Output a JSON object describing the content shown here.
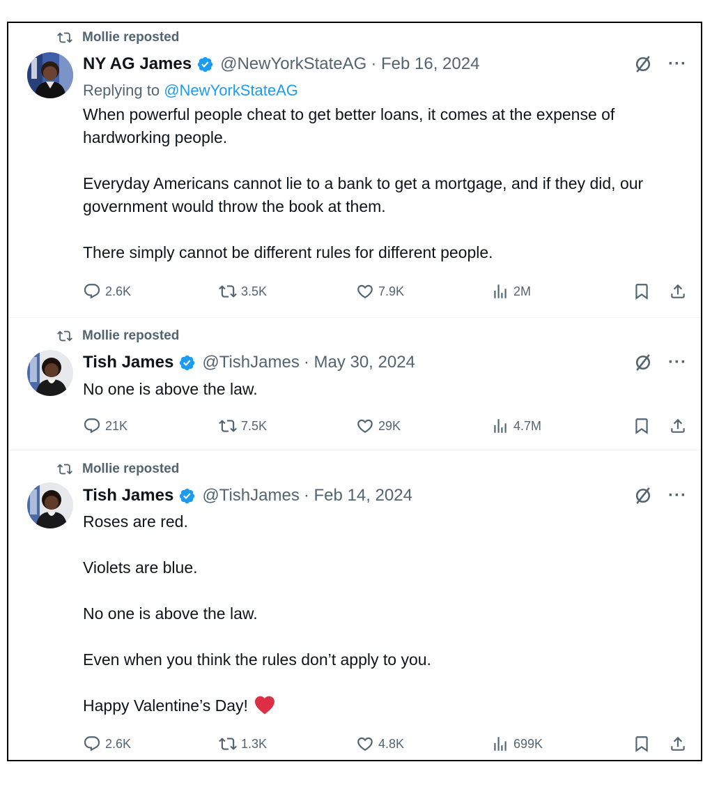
{
  "tweets": [
    {
      "repost_label": "Mollie reposted",
      "name": "NY AG James",
      "handle": "@NewYorkStateAG",
      "date": "· Feb 16, 2024",
      "replying_prefix": "Replying to",
      "replying_handle": "@NewYorkStateAG",
      "paragraphs": [
        "When powerful people cheat to get better loans, it comes at the expense of hardworking people.",
        "Everyday Americans cannot lie to a bank to get a mortgage, and if they did, our government would throw the book at them.",
        "There simply cannot be different rules for different people."
      ],
      "stats": {
        "replies": "2.6K",
        "reposts": "3.5K",
        "likes": "7.9K",
        "views": "2M"
      }
    },
    {
      "repost_label": "Mollie reposted",
      "name": "Tish James",
      "handle": "@TishJames",
      "date": "· May 30, 2024",
      "paragraphs": [
        "No one is above the law."
      ],
      "stats": {
        "replies": "21K",
        "reposts": "7.5K",
        "likes": "29K",
        "views": "4.7M"
      }
    },
    {
      "repost_label": "Mollie reposted",
      "name": "Tish James",
      "handle": "@TishJames",
      "date": "· Feb 14, 2024",
      "paragraphs": [
        "Roses are red.",
        "Violets are blue.",
        "No one is above the law.",
        "Even when you think the rules don’t apply to you.",
        "Happy Valentine’s Day!"
      ],
      "stats": {
        "replies": "2.6K",
        "reposts": "1.3K",
        "likes": "4.8K",
        "views": "699K"
      }
    }
  ],
  "icons": {
    "repost": "repost-icon",
    "verified": "verified-badge-icon",
    "grok": "grok-icon",
    "more": "more-icon",
    "reply": "reply-icon",
    "like": "heart-icon",
    "views": "views-icon",
    "bookmark": "bookmark-icon",
    "share": "share-icon",
    "emoji": "red-heart-emoji"
  },
  "colors": {
    "text": "#0f1419",
    "secondary": "#536471",
    "link": "#1d9bf0",
    "verified": "#1d9bf0",
    "emoji_heart": "#dd2e44"
  },
  "more_label": "···"
}
